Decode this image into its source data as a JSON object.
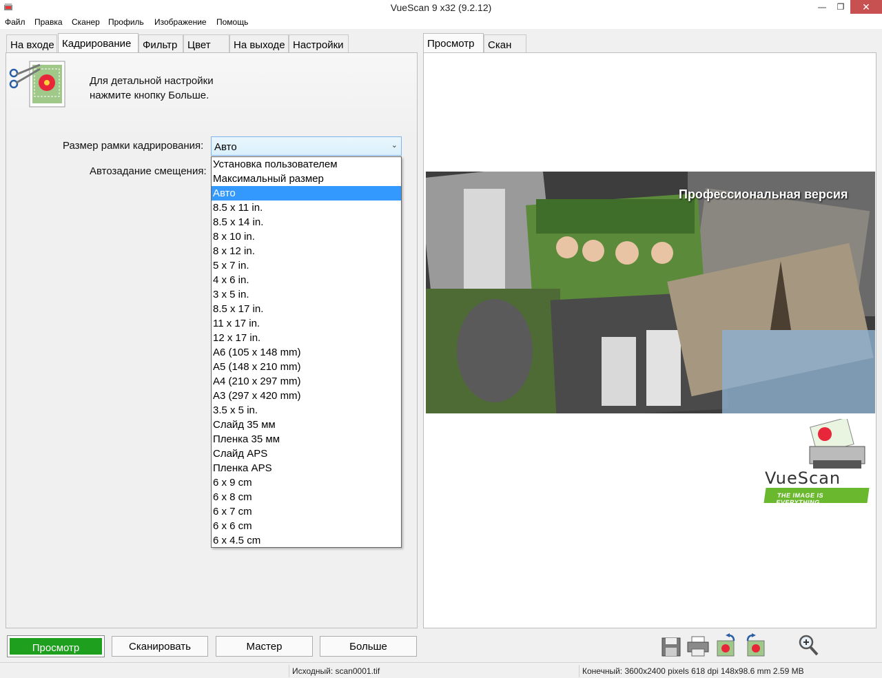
{
  "window": {
    "title": "VueScan 9 x32 (9.2.12)"
  },
  "menu": [
    "Файл",
    "Правка",
    "Сканер",
    "Профиль",
    "Изображение",
    "Помощь"
  ],
  "left_tabs": [
    "На входе",
    "Кадрирование",
    "Фильтр",
    "Цвет",
    "На выходе",
    "Настройки"
  ],
  "left_active_tab": "Кадрирование",
  "info": {
    "line1": "Для детальной настройки",
    "line2": "нажмите кнопку Больше."
  },
  "crop_size": {
    "label": "Размер рамки кадрирования:",
    "value": "Авто",
    "options": [
      "Установка пользователем",
      "Максимальный размер",
      "Авто",
      "8.5 x 11 in.",
      "8.5 x 14 in.",
      "8 x 10 in.",
      "8 x 12 in.",
      "5 x 7 in.",
      "4 x 6 in.",
      "3 x 5 in.",
      "8.5 x 17 in.",
      "11 x 17 in.",
      "12 x 17 in.",
      "A6 (105 x 148 mm)",
      "A5 (148 x 210 mm)",
      "A4 (210 x 297 mm)",
      "A3 (297 x 420 mm)",
      "3.5 x 5 in.",
      "Слайд 35 мм",
      "Пленка 35 мм",
      "Слайд APS",
      "Пленка APS",
      "6 x 9 cm",
      "6 x 8 cm",
      "6 x 7 cm",
      "6 x 6 cm",
      "6 x 4.5 cm"
    ],
    "selected_index": 2
  },
  "auto_offset": {
    "label": "Автозадание смещения:"
  },
  "right_tabs": [
    "Просмотр",
    "Скан"
  ],
  "right_active_tab": "Просмотр",
  "preview": {
    "banner": "Профессиональная версия",
    "logo": "VueScan",
    "tagline": "THE IMAGE IS EVERYTHING"
  },
  "buttons": {
    "preview": "Просмотр",
    "scan": "Сканировать",
    "wizard": "Мастер",
    "more": "Больше"
  },
  "toolbar_icons": [
    "save-icon",
    "print-icon",
    "rotate-left-icon",
    "rotate-right-icon",
    "zoom-in-icon"
  ],
  "status": {
    "source": "Исходный: scan0001.tif",
    "output": "Конечный: 3600x2400 pixels 618 dpi 148x98.6 mm 2.59 MB"
  },
  "colors": {
    "accent_green": "#1e9f1e",
    "selection_blue": "#3399ff",
    "close_red": "#c75050"
  }
}
